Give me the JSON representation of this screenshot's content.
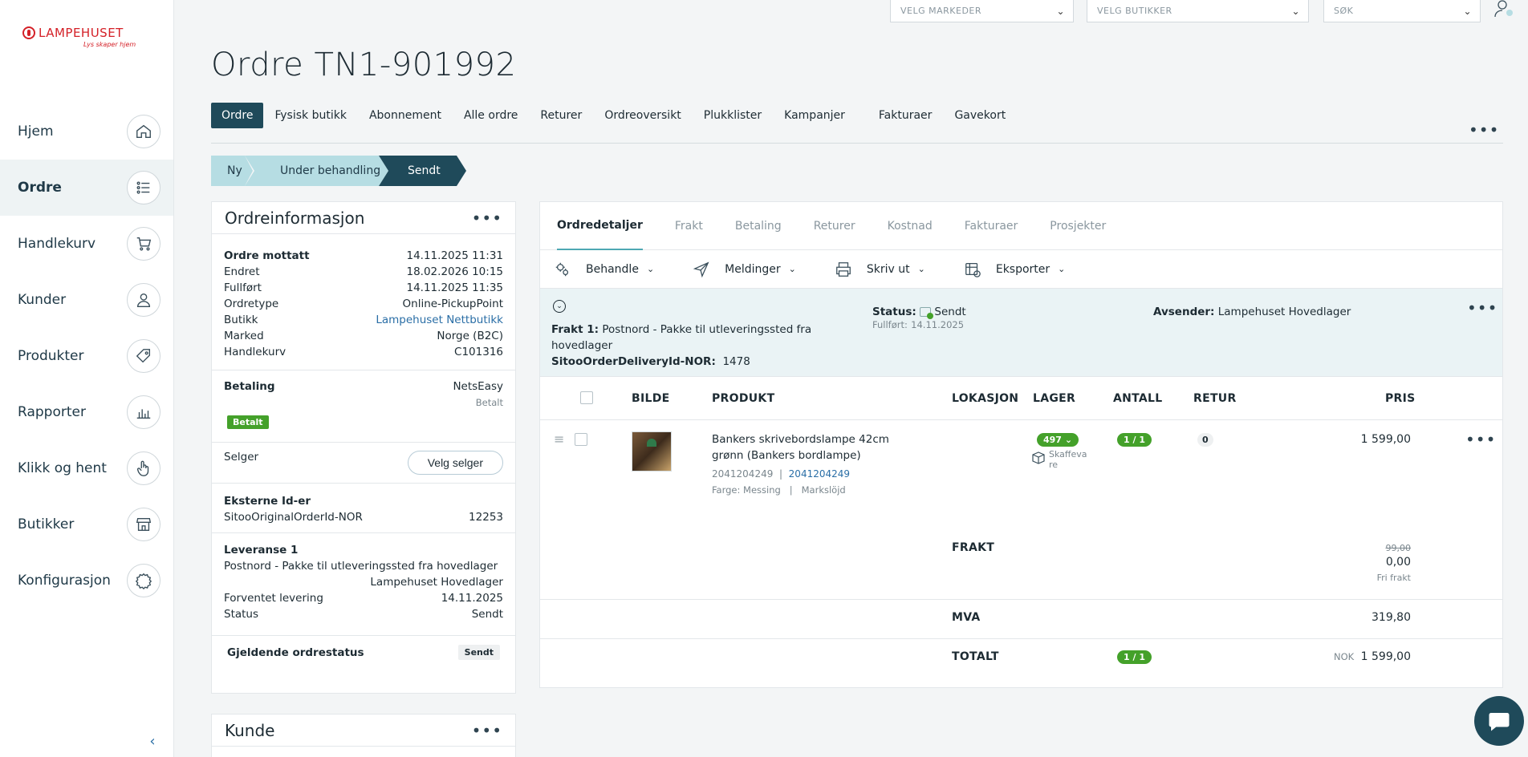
{
  "brand": {
    "name": "LAMPEHUSET",
    "tagline": "Lys skaper hjem"
  },
  "sidebar": {
    "items": [
      {
        "label": "Hjem",
        "icon": "home-icon"
      },
      {
        "label": "Ordre",
        "icon": "list-icon"
      },
      {
        "label": "Handlekurv",
        "icon": "cart-icon"
      },
      {
        "label": "Kunder",
        "icon": "user-icon"
      },
      {
        "label": "Produkter",
        "icon": "tag-icon"
      },
      {
        "label": "Rapporter",
        "icon": "chart-icon"
      },
      {
        "label": "Klikk og hent",
        "icon": "hand-icon"
      },
      {
        "label": "Butikker",
        "icon": "store-icon"
      },
      {
        "label": "Konfigurasjon",
        "icon": "gear-icon"
      }
    ],
    "active": "Ordre"
  },
  "top": {
    "markets": "VELG MARKEDER",
    "stores": "VELG BUTIKKER",
    "search": "SØK"
  },
  "page": {
    "title": "Ordre TN1-901992"
  },
  "tabs": [
    "Ordre",
    "Fysisk butikk",
    "Abonnement",
    "Alle ordre",
    "Returer",
    "Ordreoversikt",
    "Plukklister",
    "Kampanjer",
    "Fakturaer",
    "Gavekort"
  ],
  "steps": [
    "Ny",
    "Under behandling",
    "Sendt"
  ],
  "order_info": {
    "title": "Ordreinformasjon",
    "received_label": "Ordre mottatt",
    "received": "14.11.2025 11:31",
    "changed_label": "Endret",
    "changed": "18.02.2026 10:15",
    "completed_label": "Fullført",
    "completed": "14.11.2025 11:35",
    "type_label": "Ordretype",
    "type": "Online-PickupPoint",
    "store_label": "Butikk",
    "store": "Lampehuset Nettbutikk",
    "market_label": "Marked",
    "market": "Norge (B2C)",
    "cart_label": "Handlekurv",
    "cart": "C101316",
    "payment_label": "Betaling",
    "payment_provider": "NetsEasy",
    "payment_status_small": "Betalt",
    "payment_badge": "Betalt",
    "seller_label": "Selger",
    "seller_button": "Velg selger",
    "ext_ids_label": "Eksterne Id-er",
    "ext_id_key": "SitooOriginalOrderId-NOR",
    "ext_id_val": "12253",
    "delivery_label": "Leveranse 1",
    "delivery_method": "Postnord - Pakke til utleveringssted fra hovedlager",
    "delivery_warehouse": "Lampehuset Hovedlager",
    "expected_label": "Forventet levering",
    "expected": "14.11.2025",
    "status_label": "Status",
    "status": "Sendt",
    "current_status_label": "Gjeldende ordrestatus",
    "current_status": "Sendt"
  },
  "customer": {
    "title": "Kunde"
  },
  "detail": {
    "subtabs": [
      "Ordredetaljer",
      "Frakt",
      "Betaling",
      "Returer",
      "Kostnad",
      "Fakturaer",
      "Prosjekter"
    ],
    "actions": [
      {
        "label": "Behandle",
        "icon": "gears-icon"
      },
      {
        "label": "Meldinger",
        "icon": "send-icon"
      },
      {
        "label": "Skriv ut",
        "icon": "print-icon"
      },
      {
        "label": "Eksporter",
        "icon": "export-icon"
      }
    ],
    "shipment": {
      "label": "Frakt 1:",
      "method": "Postnord - Pakke til utleveringssted fra hovedlager",
      "delivery_id_label": "SitooOrderDeliveryId-NOR:",
      "delivery_id": "1478",
      "status_label": "Status:",
      "status": "Sendt",
      "completed_label": "Fullført:",
      "completed": "14.11.2025",
      "sender_label": "Avsender:",
      "sender": "Lampehuset Hovedlager"
    },
    "columns": [
      "BILDE",
      "PRODUKT",
      "LOKASJON",
      "LAGER",
      "ANTALL",
      "RETUR",
      "PRIS"
    ],
    "line": {
      "name": "Bankers skrivebordslampe 42cm grønn (Bankers bordlampe)",
      "sku": "2041204249",
      "sku_link": "2041204249",
      "variant": "Farge: Messing",
      "brand": "Markslöjd",
      "stock": "497",
      "stock_note": "Skaffevare",
      "qty": "1 / 1",
      "returned": "0",
      "price": "1 599,00"
    },
    "freight_label": "FRAKT",
    "freight_old": "99,00",
    "freight": "0,00",
    "freight_note": "Fri frakt",
    "vat_label": "MVA",
    "vat": "319,80",
    "total_label": "TOTALT",
    "total_qty": "1 / 1",
    "currency": "NOK",
    "total": "1 599,00"
  }
}
